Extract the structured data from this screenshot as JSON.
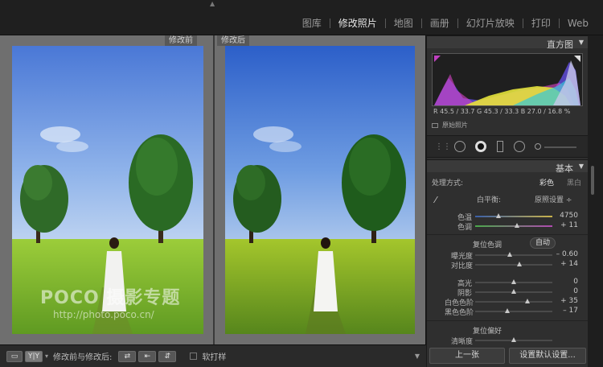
{
  "modules": [
    "图库",
    "修改照片",
    "地图",
    "画册",
    "幻灯片放映",
    "打印",
    "Web"
  ],
  "active_module": "修改照片",
  "panes": {
    "before_label": "修改前",
    "after_label": "修改后"
  },
  "watermark": {
    "brand": "POCO 摄影专题",
    "url": "http://photo.poco.cn/"
  },
  "bottom_toolbar": {
    "view_loupe": "▭",
    "view_compare": "Y|Y",
    "compare_label": "修改前与修改后:",
    "swap1": "⇄",
    "swap2": "⇤",
    "swap3": "⇵",
    "soft_proof": "软打样"
  },
  "histogram": {
    "title": "直方图",
    "readout": "R  45.5 / 33.7   G  45.3 / 33.3   B  27.0 / 16.8  %",
    "original_photo": "原始照片"
  },
  "basic": {
    "title": "基本",
    "treatment_label": "处理方式:",
    "color": "彩色",
    "bw": "黑白",
    "wb_label": "白平衡:",
    "wb_value": "原照设置 ÷",
    "temp_label": "色温",
    "temp_value": "4750",
    "tint_label": "色调",
    "tint_value": "+ 11",
    "tone_title": "复位色调",
    "auto": "自动",
    "exposure_label": "曝光度",
    "exposure_value": "– 0.60",
    "contrast_label": "对比度",
    "contrast_value": "+ 14",
    "highlights_label": "高光",
    "highlights_value": "0",
    "shadows_label": "阴影",
    "shadows_value": "0",
    "whites_label": "白色色阶",
    "whites_value": "+ 35",
    "blacks_label": "黑色色阶",
    "blacks_value": "– 17",
    "presence_title": "复位偏好",
    "clarity_label": "清晰度"
  },
  "panel_buttons": {
    "previous": "上一张",
    "reset": "设置默认设置..."
  },
  "colors": {
    "sky": "#3b6fd0",
    "grass": "#8fbf2e",
    "panel": "#2f2f2f",
    "work_bg": "#6f6f6f"
  }
}
